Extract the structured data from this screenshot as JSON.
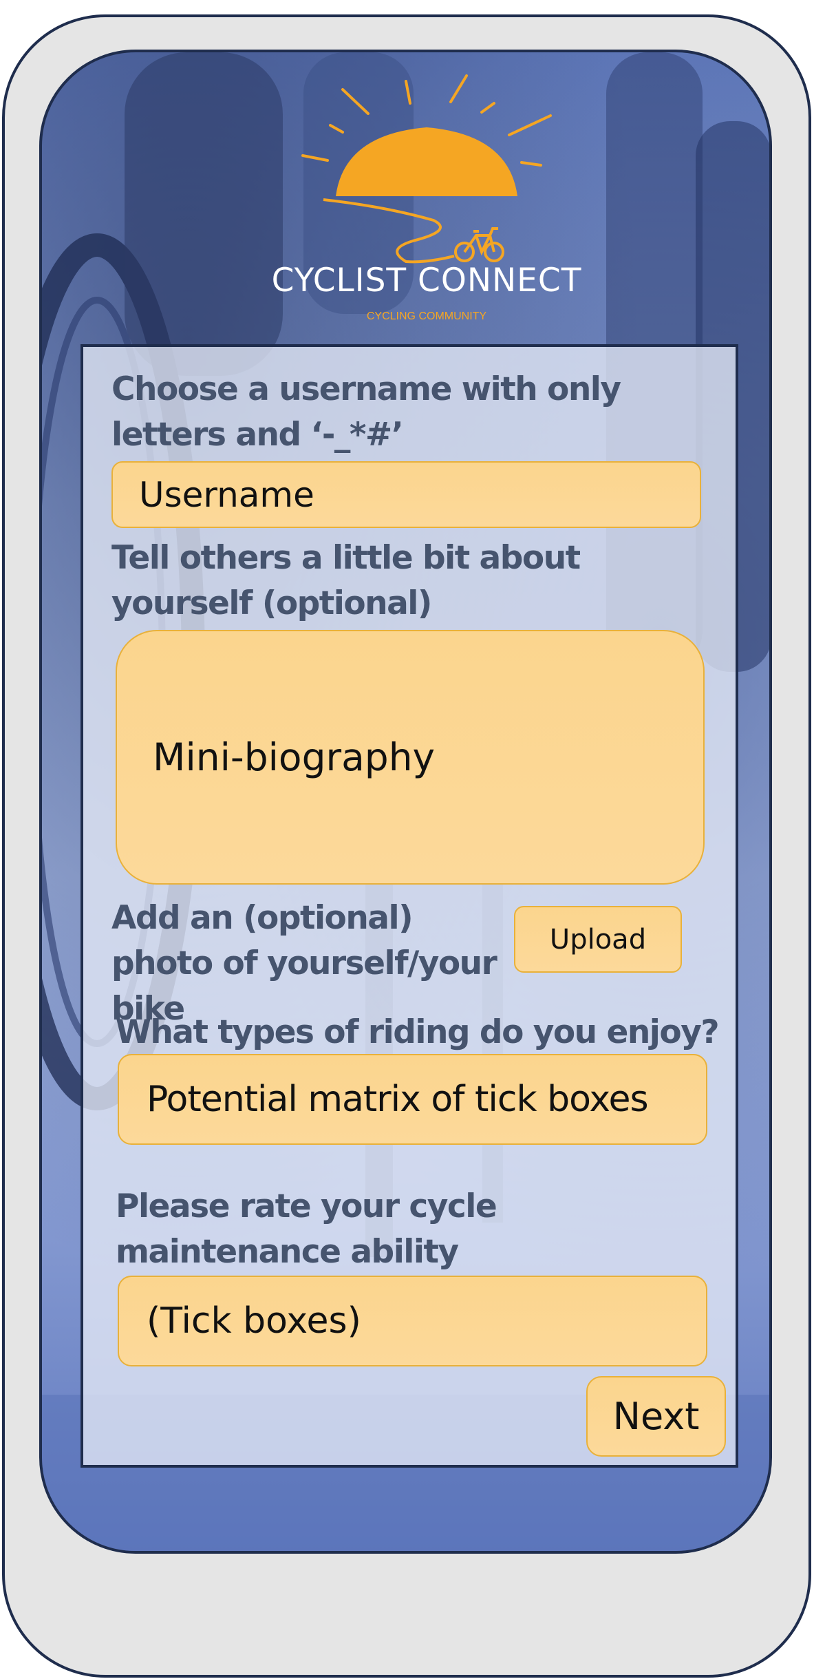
{
  "app": {
    "brand_title": "CYCLIST CONNECT",
    "brand_subtitle": "CYCLING COMMUNITY",
    "logo_icon": "sun-and-bicycle-logo",
    "accent_color": "#f5a623"
  },
  "form": {
    "username_label": "Choose a username with only letters and ‘-_*#’",
    "username_placeholder": "Username",
    "bio_label": "Tell others a little bit about yourself (optional)",
    "bio_placeholder": "Mini-biography",
    "photo_label": "Add an (optional) photo of yourself/your bike",
    "upload_label": "Upload",
    "riding_label": "What types of riding do you enjoy?",
    "riding_placeholder": "Potential matrix of tick boxes",
    "maintenance_label": "Please rate your cycle maintenance ability",
    "maintenance_placeholder": "(Tick boxes)",
    "next_label": "Next"
  }
}
